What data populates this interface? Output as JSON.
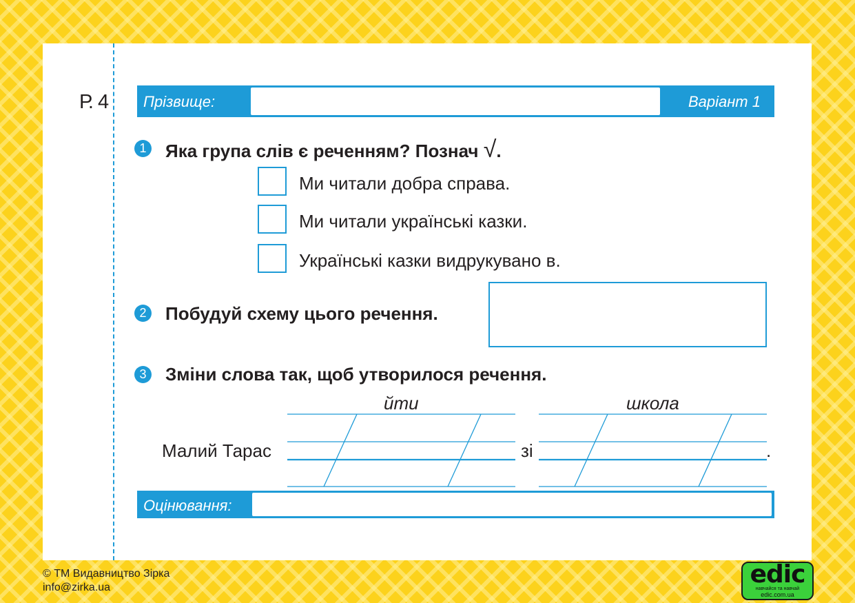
{
  "header": {
    "page_code": "Р. 4",
    "surname_label": "Прізвище:",
    "variant_label": "Варіант 1"
  },
  "task1": {
    "number": "1",
    "question": "Яка група слів є реченням? Познач ",
    "check_mark": "√",
    "question_end": ".",
    "options": [
      "Ми читали добра справа.",
      "Ми читали українські казки.",
      "Українські казки видрукувано в."
    ]
  },
  "task2": {
    "number": "2",
    "question": "Побудуй схему цього речення."
  },
  "task3": {
    "number": "3",
    "question": "Зміни слова так, щоб утворилося речення.",
    "sentence_start": "Малий Тарас",
    "word1": "йти",
    "connector": "зі",
    "word2": "школа",
    "sentence_end": "."
  },
  "grading": {
    "label": "Оцінювання:"
  },
  "footer": {
    "copyright": "© ТМ Видавництво Зірка",
    "email": "info@zirka.ua"
  },
  "logo": {
    "name": "edic",
    "tagline": "навчайся та навчай",
    "url": "edic.com.ua"
  },
  "colors": {
    "accent": "#1e9bd7",
    "background": "#fcd21c",
    "logo": "#3bd13b"
  }
}
